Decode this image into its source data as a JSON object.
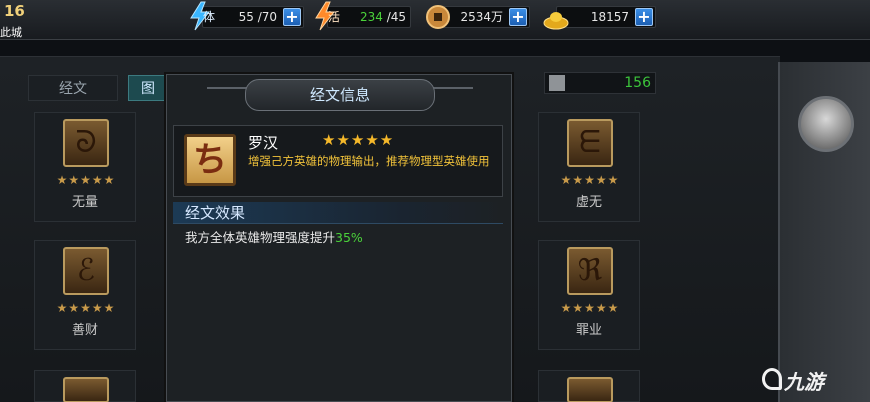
{
  "player": {
    "level": "16",
    "city": "此城"
  },
  "resources": [
    {
      "name": "stamina",
      "icon": "lightning-stamina-icon",
      "label": "体",
      "current": "55",
      "max": "/70"
    },
    {
      "name": "vigor",
      "icon": "lightning-vigor-icon",
      "label": "活",
      "current": "234",
      "max": "/45"
    },
    {
      "name": "copper",
      "icon": "coin-icon",
      "value": "2534万"
    },
    {
      "name": "gold",
      "icon": "gold-ingot-icon",
      "value": "18157"
    }
  ],
  "plus_label": "+",
  "tabs": [
    {
      "label": "经文"
    },
    {
      "label": "图"
    }
  ],
  "count": {
    "value": "156"
  },
  "cards_left": [
    {
      "name": "无量",
      "stars": "★★★★★",
      "glyph": "ᘐ"
    },
    {
      "name": "善财",
      "stars": "★★★★★",
      "glyph": "ℰ"
    }
  ],
  "cards_right": [
    {
      "name": "虚无",
      "stars": "★★★★★",
      "glyph": "ᗴ"
    },
    {
      "name": "罪业",
      "stars": "★★★★★",
      "glyph": "ℜ"
    }
  ],
  "modal": {
    "title": "经文信息",
    "scripture": {
      "name": "罗汉",
      "stars": "★★★★★",
      "glyph": "ち",
      "description": "增强己方英雄的物理输出，推荐物理型英雄使用"
    },
    "effect_title": "经文效果",
    "effect_text": "我方全体英雄物理强度提升",
    "effect_value": "35%"
  },
  "watermark": "九游",
  "colors": {
    "accent_green": "#4ad23a",
    "desc_yellow": "#f2c33a",
    "star_gold": "#f5b82a"
  }
}
